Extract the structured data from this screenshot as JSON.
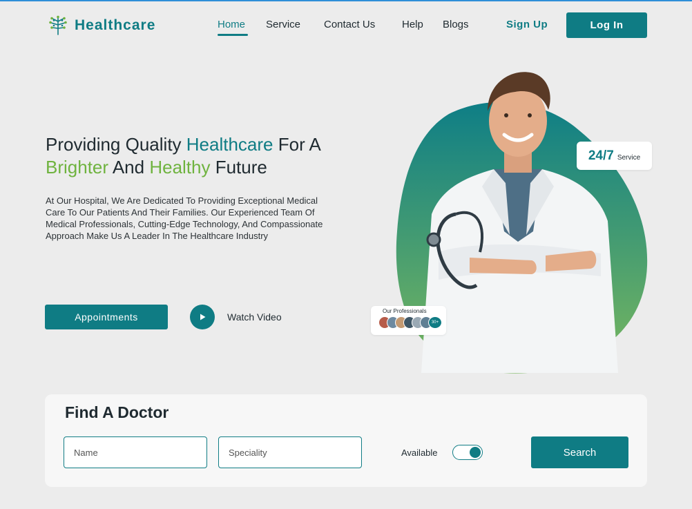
{
  "brand": {
    "name": "Healthcare",
    "accent": "#0f7c84",
    "green": "#6fb33f"
  },
  "nav": {
    "items": [
      {
        "label": "Home",
        "active": true
      },
      {
        "label": "Service"
      },
      {
        "label": "Contact Us"
      },
      {
        "label": "Help"
      },
      {
        "label": "Blogs"
      }
    ],
    "signup_label": "Sign Up",
    "login_label": "Log In"
  },
  "hero": {
    "headline": {
      "p1": "Providing Quality ",
      "p2": "Healthcare",
      "p3": " For A ",
      "p4": "Brighter",
      "p5": " And ",
      "p6": "Healthy",
      "p7": " Future"
    },
    "description": "At Our Hospital, We Are Dedicated To Providing Exceptional Medical Care To Our Patients And Their Families. Our Experienced Team Of Medical Professionals, Cutting-Edge Technology, And Compassionate Approach Make Us A Leader In The Healthcare Industry",
    "appointments_label": "Appointments",
    "watch_video_label": "Watch Video",
    "badge_service": {
      "big": "24/7",
      "small": "Service"
    },
    "professionals": {
      "title": "Our Professionals",
      "count": "30+"
    }
  },
  "finder": {
    "title": "Find A Doctor",
    "name_placeholder": "Name",
    "speciality_placeholder": "Speciality",
    "available_label": "Available",
    "available_on": true,
    "search_label": "Search"
  }
}
